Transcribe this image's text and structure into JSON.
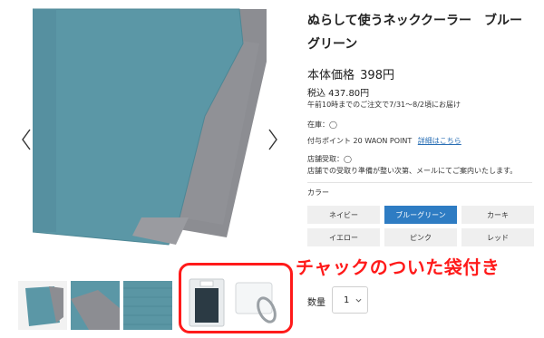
{
  "product": {
    "title": "ぬらして使うネッククーラー　ブルーグリーン",
    "price_label": "本体価格",
    "price_value": "398円",
    "price_tax": "税込 437.80円",
    "delivery": "午前10時までのご注文で7/31～8/2頃にお届け",
    "stock": "在庫：◯",
    "points": "付与ポイント 20 WAON POINT",
    "points_link": "詳細はこちら",
    "store_pickup": "店舗受取：◯",
    "store_note": "店舗での受取り準備が整い次第、メールにてご案内いたします。",
    "color_label": "カラー",
    "colors": [
      "ネイビー",
      "ブルーグリーン",
      "カーキ",
      "イエロー",
      "ピンク",
      "レッド"
    ],
    "selected_color": "ブルーグリーン",
    "qty_label": "数量",
    "qty_value": "1"
  },
  "gallery": {
    "promo_text": "チャックのついた袋付き",
    "icons": [
      "chevron-left-icon",
      "chevron-right-icon",
      "chevron-down-icon"
    ]
  },
  "colors": {
    "towel_teal": "#5b97a6",
    "towel_gray": "#8c8d92",
    "accent_blue": "#2e7cc3",
    "promo_red": "#ff1a1a"
  }
}
